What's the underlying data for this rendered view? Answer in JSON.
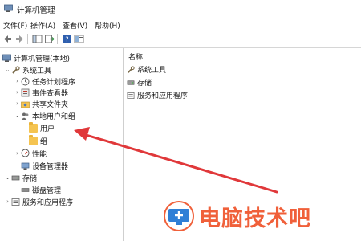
{
  "window": {
    "title": "计算机管理",
    "icon": "computer-management-icon"
  },
  "menu": [
    {
      "label": "文件(F)"
    },
    {
      "label": "操作(A)"
    },
    {
      "label": "查看(V)"
    },
    {
      "label": "帮助(H)"
    }
  ],
  "toolbar": {
    "icons": [
      "back-arrow-icon",
      "forward-arrow-icon",
      "show-hide-tree-icon",
      "export-list-icon",
      "help-icon",
      "properties-icon"
    ]
  },
  "tree": {
    "root": "计算机管理(本地)",
    "system_tools": "系统工具",
    "task_scheduler": "任务计划程序",
    "event_viewer": "事件查看器",
    "shared_folders": "共享文件夹",
    "local_users_groups": "本地用户和组",
    "users": "用户",
    "groups": "组",
    "performance": "性能",
    "device_manager": "设备管理器",
    "storage": "存储",
    "disk_management": "磁盘管理",
    "services_apps": "服务和应用程序"
  },
  "content": {
    "column_header": "名称",
    "items": [
      "系统工具",
      "存储",
      "服务和应用程序"
    ]
  },
  "colors": {
    "arrow": "#e0383a",
    "watermark": "#f0603a",
    "folder": "#f5c451"
  },
  "watermark": {
    "text": "电脑技术吧",
    "logo": "computer-plus-logo"
  }
}
